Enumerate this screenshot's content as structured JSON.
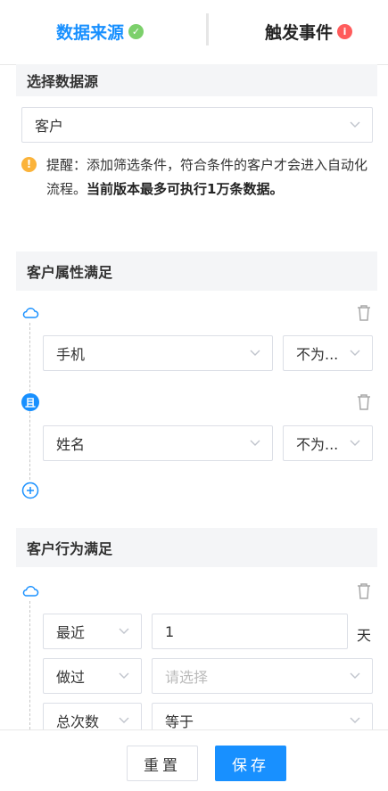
{
  "tabs": [
    {
      "label": "数据来源",
      "status": "check"
    },
    {
      "label": "触发事件",
      "status": "alert"
    }
  ],
  "data_source": {
    "heading": "选择数据源",
    "selected": "客户",
    "tip_prefix": "提醒：添加筛选条件，符合条件的客户才会进入自动化流程。",
    "tip_bold": "当前版本最多可执行1万条数据。"
  },
  "attributes": {
    "heading": "客户属性满足",
    "rows": [
      {
        "field": "手机",
        "operator": "不为..."
      },
      {
        "field": "姓名",
        "operator": "不为..."
      }
    ],
    "join_label": "且"
  },
  "behavior": {
    "heading": "客户行为满足",
    "time_select": "最近",
    "time_value": "1",
    "time_unit": "天",
    "action_select": "做过",
    "action_placeholder": "请选择",
    "metric_select": "总次数",
    "compare_select": "等于"
  },
  "footer": {
    "reset": "重置",
    "save": "保存"
  },
  "colors": {
    "accent": "#1890ff",
    "ok": "#7cd06b",
    "alert": "#ff5c5c",
    "tip": "#fbb33a"
  }
}
